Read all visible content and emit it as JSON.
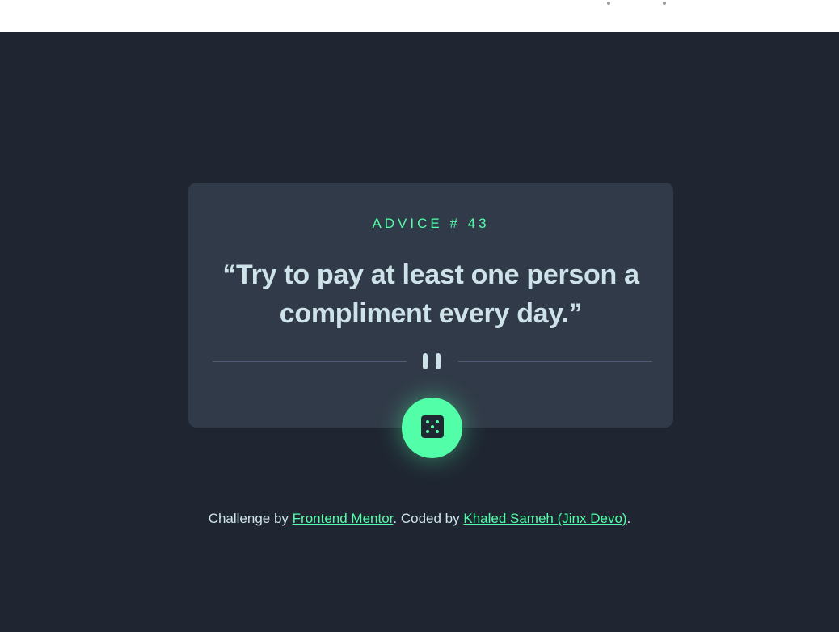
{
  "advice": {
    "number_label": "ADVICE # 43",
    "text": "“Try to pay at least one person a compliment every day.”"
  },
  "divider": {
    "icon": "pause-icon"
  },
  "dice_button": {
    "icon": "dice-icon"
  },
  "footer": {
    "prefix": "Challenge by ",
    "link1": "Frontend Mentor",
    "middle": ". Coded by ",
    "link2": "Khaled Sameh (Jinx Devo)",
    "suffix": "."
  },
  "colors": {
    "background": "#1f2632",
    "card": "#313a48",
    "accent": "#52ffa8",
    "text": "#cee3e9",
    "divider": "#4f5d74"
  }
}
